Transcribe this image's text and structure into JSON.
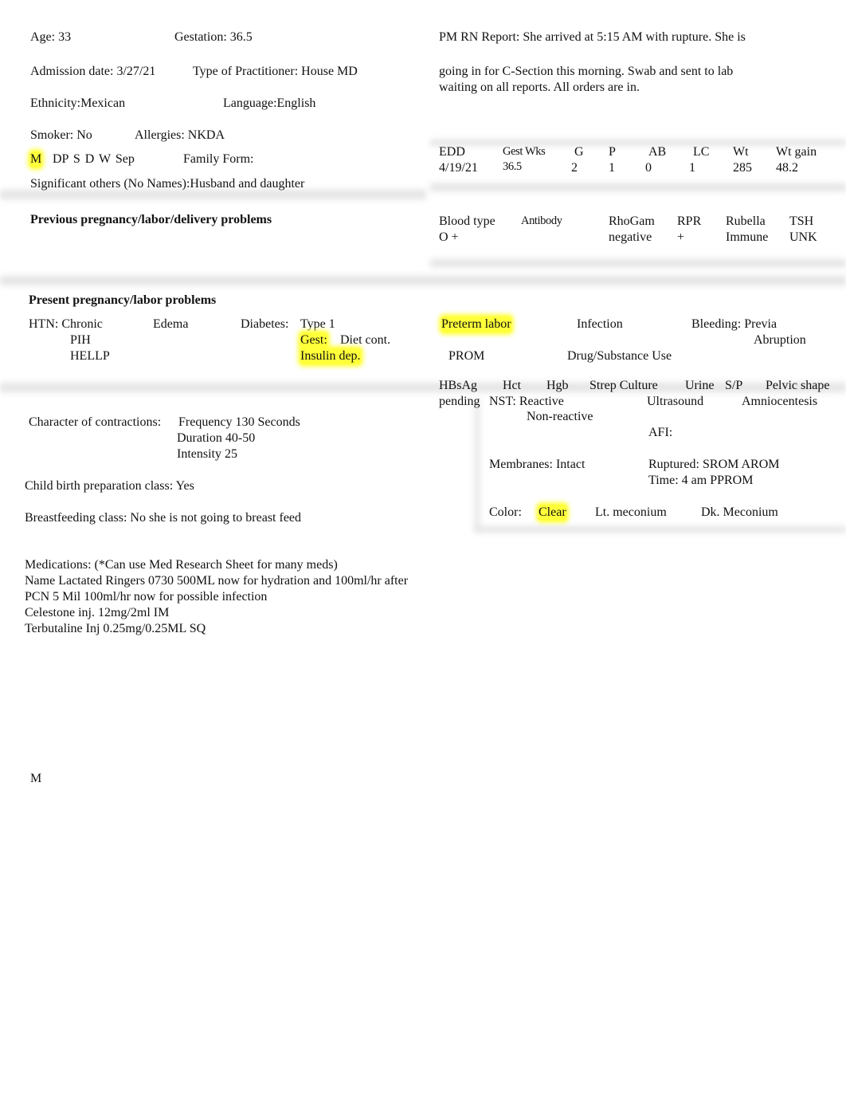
{
  "patient": {
    "age": "Age:   33",
    "gestation": "Gestation: 36.5",
    "admission": "Admission date: 3/27/21",
    "practitioner": "Type of Practitioner: House MD",
    "ethnicity": "Ethnicity:Mexican",
    "language": "Language:English",
    "smoker": "Smoker:    No",
    "allergies": "Allergies: NKDA",
    "marital_selected": "M",
    "marital_rest": "DP  S   D   W   Sep",
    "family_form": "Family Form:",
    "significant_others": "Significant others (No Names):Husband and daughter"
  },
  "report": {
    "line1": "PM RN Report: She arrived at 5:15 AM with rupture.  She is",
    "line2": "going in for C-Section this morning. Swab and sent to lab",
    "line3": "waiting on all reports.  All orders are in."
  },
  "prenatal_table": {
    "headers": [
      "EDD",
      "Gest Wks",
      "G",
      "P",
      "AB",
      "LC",
      "Wt",
      "Wt gain"
    ],
    "values": [
      "4/19/21",
      "36.5",
      "2",
      "1",
      "0",
      "1",
      "285",
      "48.2"
    ]
  },
  "labs_table": {
    "headers": [
      "Blood type",
      "Antibody",
      "RhoGam",
      "RPR",
      "Rubella",
      "TSH"
    ],
    "values": [
      "O +",
      "",
      "negative",
      "+",
      "Immune",
      "UNK"
    ]
  },
  "previous_problems_title": "Previous pregnancy/labor/delivery problems",
  "present": {
    "title": "Present pregnancy/labor problems",
    "htn": "HTN: Chronic",
    "pih": "PIH",
    "hellp": "HELLP",
    "edema": "Edema",
    "diabetes": "Diabetes:",
    "type1": "Type 1",
    "gest": "Gest:",
    "diet": "Diet cont.",
    "insulin": "Insulin dep.",
    "preterm": "Preterm labor",
    "infection": "Infection",
    "bleeding": "Bleeding:  Previa",
    "abruption": "Abruption",
    "prom": "PROM",
    "drug": "Drug/Substance Use"
  },
  "tests": {
    "headers": [
      "HBsAg",
      "Hct",
      "Hgb",
      "Strep Culture",
      "Urine",
      "S/P",
      "Pelvic shape"
    ],
    "hbsag_value": "pending",
    "nst": "NST:  Reactive",
    "nonreactive": "Non-reactive",
    "ultrasound": "Ultrasound",
    "amnio": "Amniocentesis",
    "afi": "AFI:",
    "membranes": "Membranes:   Intact",
    "ruptured": "Ruptured:   SROM   AROM",
    "time": "Time:   4 am         PPROM",
    "color_label": "Color:",
    "color_selected": "Clear",
    "lt": "Lt. meconium",
    "dk": "Dk. Meconium"
  },
  "contractions": {
    "label": "Character of contractions:",
    "frequency": "Frequency    130 Seconds",
    "duration": "Duration      40-50",
    "intensity": "Intensity       25"
  },
  "childbirth_class": "Child birth preparation class: Yes",
  "breastfeeding_class": "Breastfeeding class: No she is not going to breast feed",
  "medications": {
    "title": "Medications: (*Can use Med Research Sheet for many meds)",
    "lines": [
      "Name   Lactated Ringers 0730 500ML now for hydration and 100ml/hr after",
      "PCN 5 Mil 100ml/hr now for possible infection",
      "Celestone inj. 12mg/2ml IM",
      "Terbutaline Inj 0.25mg/0.25ML SQ"
    ]
  },
  "footer_letter": "M",
  "colors": {
    "highlight": "#ffff3a",
    "shadow": "#e4e4e4"
  }
}
